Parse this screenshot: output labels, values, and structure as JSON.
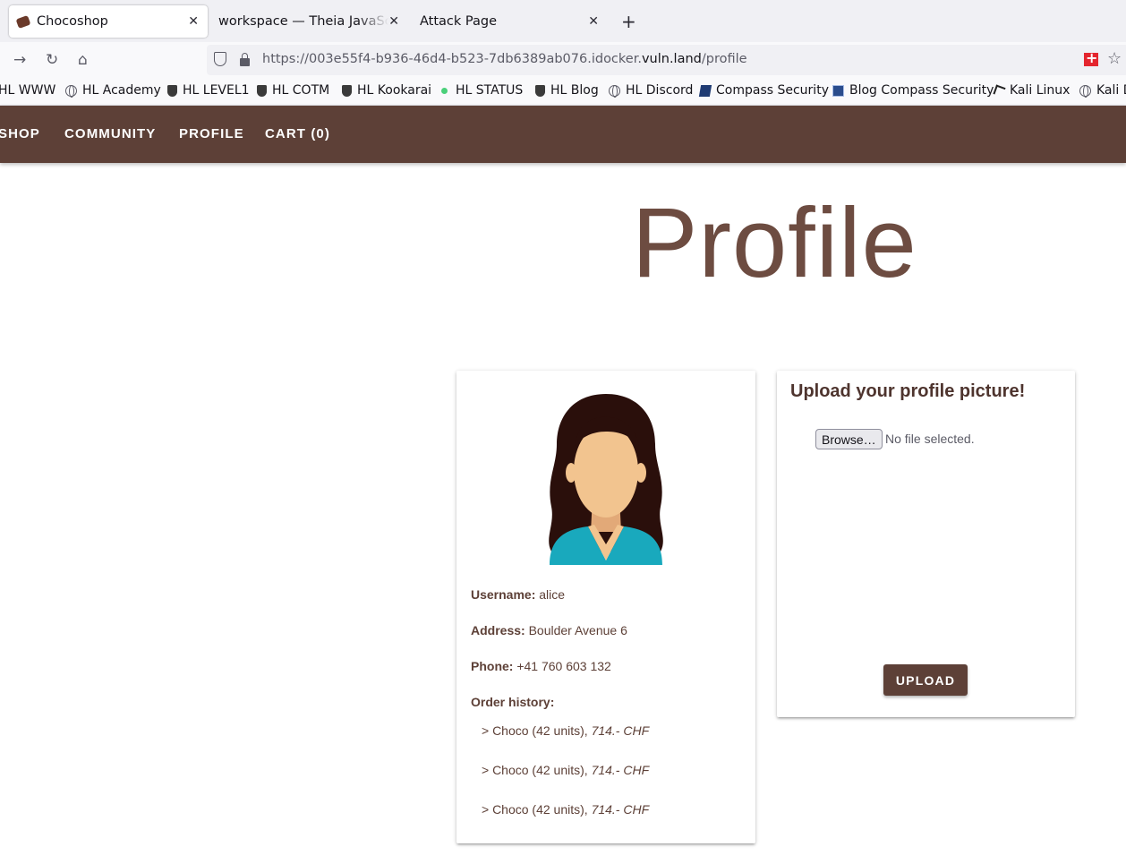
{
  "browser": {
    "tabs": [
      {
        "title": "Chocoshop",
        "active": true
      },
      {
        "title": "workspace — Theia JavaScript",
        "active": false
      },
      {
        "title": "Attack Page",
        "active": false
      }
    ],
    "url": {
      "prefix": "https://003e55f4-b936-46d4-b523-7db6389ab076.idocker.",
      "domain": "vuln.land",
      "path": "/profile"
    },
    "bookmarks": [
      {
        "label": "HL WWW",
        "icon": "none"
      },
      {
        "label": "HL Academy",
        "icon": "globe-icon"
      },
      {
        "label": "HL LEVEL1",
        "icon": "shield-icon"
      },
      {
        "label": "HL COTM",
        "icon": "shield-icon"
      },
      {
        "label": "HL Kookarai",
        "icon": "shield-icon"
      },
      {
        "label": "HL STATUS",
        "icon": "status-dot-icon"
      },
      {
        "label": "HL Blog",
        "icon": "shield-icon"
      },
      {
        "label": "HL Discord",
        "icon": "globe-icon"
      },
      {
        "label": "Compass Security",
        "icon": "compass-icon"
      },
      {
        "label": "Blog Compass Security",
        "icon": "blog-icon"
      },
      {
        "label": "Kali Linux",
        "icon": "kali-icon"
      },
      {
        "label": "Kali D",
        "icon": "globe-icon"
      }
    ],
    "accent": "#5d4037"
  },
  "app": {
    "nav": [
      "SHOP",
      "COMMUNITY",
      "PROFILE",
      "CART (0)"
    ],
    "page_title": "Profile",
    "profile": {
      "username_label": "Username:",
      "username": "alice",
      "address_label": "Address:",
      "address": "Boulder Avenue 6",
      "phone_label": "Phone:",
      "phone": "+41 760 603 132",
      "order_history_label": "Order history:",
      "orders": [
        {
          "item": "> Choco (42 units),",
          "price": "714.- CHF"
        },
        {
          "item": "> Choco (42 units),",
          "price": "714.- CHF"
        },
        {
          "item": "> Choco (42 units),",
          "price": "714.- CHF"
        }
      ]
    },
    "upload": {
      "title": "Upload your profile picture!",
      "browse_label": "Browse…",
      "no_file": "No file selected.",
      "button": "UPLOAD"
    }
  }
}
